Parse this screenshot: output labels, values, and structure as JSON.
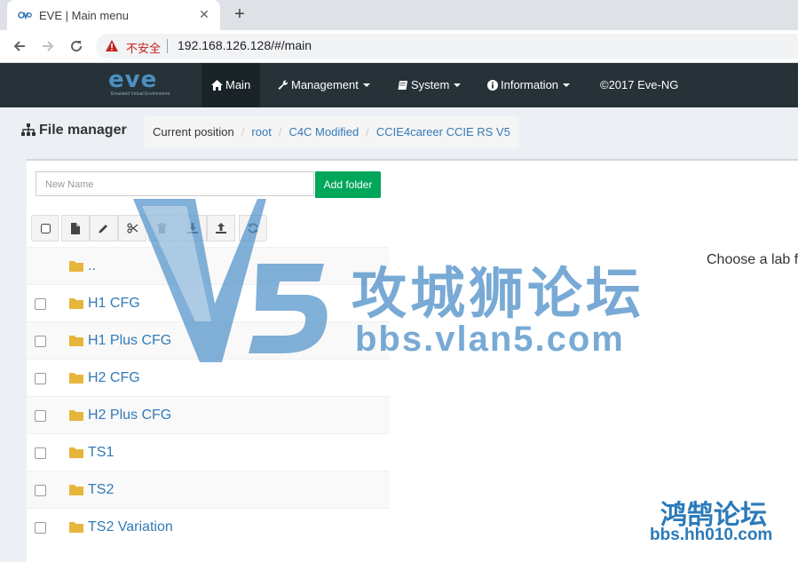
{
  "browser": {
    "tab_title": "EVE | Main menu",
    "security_label": "不安全",
    "url": "192.168.126.128/#/main"
  },
  "navbar": {
    "logo_text": "eve",
    "logo_sub": "Emulated Virtual Environment",
    "items": [
      {
        "label": "Main",
        "icon": "home-icon"
      },
      {
        "label": "Management",
        "icon": "wrench-icon"
      },
      {
        "label": "System",
        "icon": "book-icon"
      },
      {
        "label": "Information",
        "icon": "info-circle-icon"
      },
      {
        "label": "©2017 Eve-NG"
      }
    ]
  },
  "file_manager": {
    "title": "File manager",
    "breadcrumb": [
      "Current position",
      "root",
      "C4C Modified",
      "CCIE4career CCIE RS V5"
    ]
  },
  "new_folder": {
    "placeholder": "New  Name",
    "button_label": "Add folder"
  },
  "toolbar_icons": [
    "checkbox-icon",
    "new-file-icon",
    "pencil-icon",
    "scissors-icon",
    "trash-icon",
    "download-icon",
    "upload-icon",
    "refresh-icon"
  ],
  "files": [
    {
      "name": "..",
      "checkbox": false
    },
    {
      "name": "H1 CFG",
      "checkbox": true
    },
    {
      "name": "H1 Plus CFG",
      "checkbox": true
    },
    {
      "name": "H2 CFG",
      "checkbox": true
    },
    {
      "name": "H2 Plus CFG",
      "checkbox": true
    },
    {
      "name": "TS1",
      "checkbox": true
    },
    {
      "name": "TS2",
      "checkbox": true
    },
    {
      "name": "TS2 Variation",
      "checkbox": true
    }
  ],
  "preview_text": "Choose a lab f",
  "watermarks": {
    "main_text": "攻城狮论坛",
    "main_url": "bbs.vlan5.com",
    "corner_text": "鸿鹄论坛",
    "corner_url": "bbs.hh010.com"
  },
  "colors": {
    "navbar_bg": "#263238",
    "add_button": "#00a65a",
    "link": "#337ab7",
    "folder": "#e8b53c"
  }
}
